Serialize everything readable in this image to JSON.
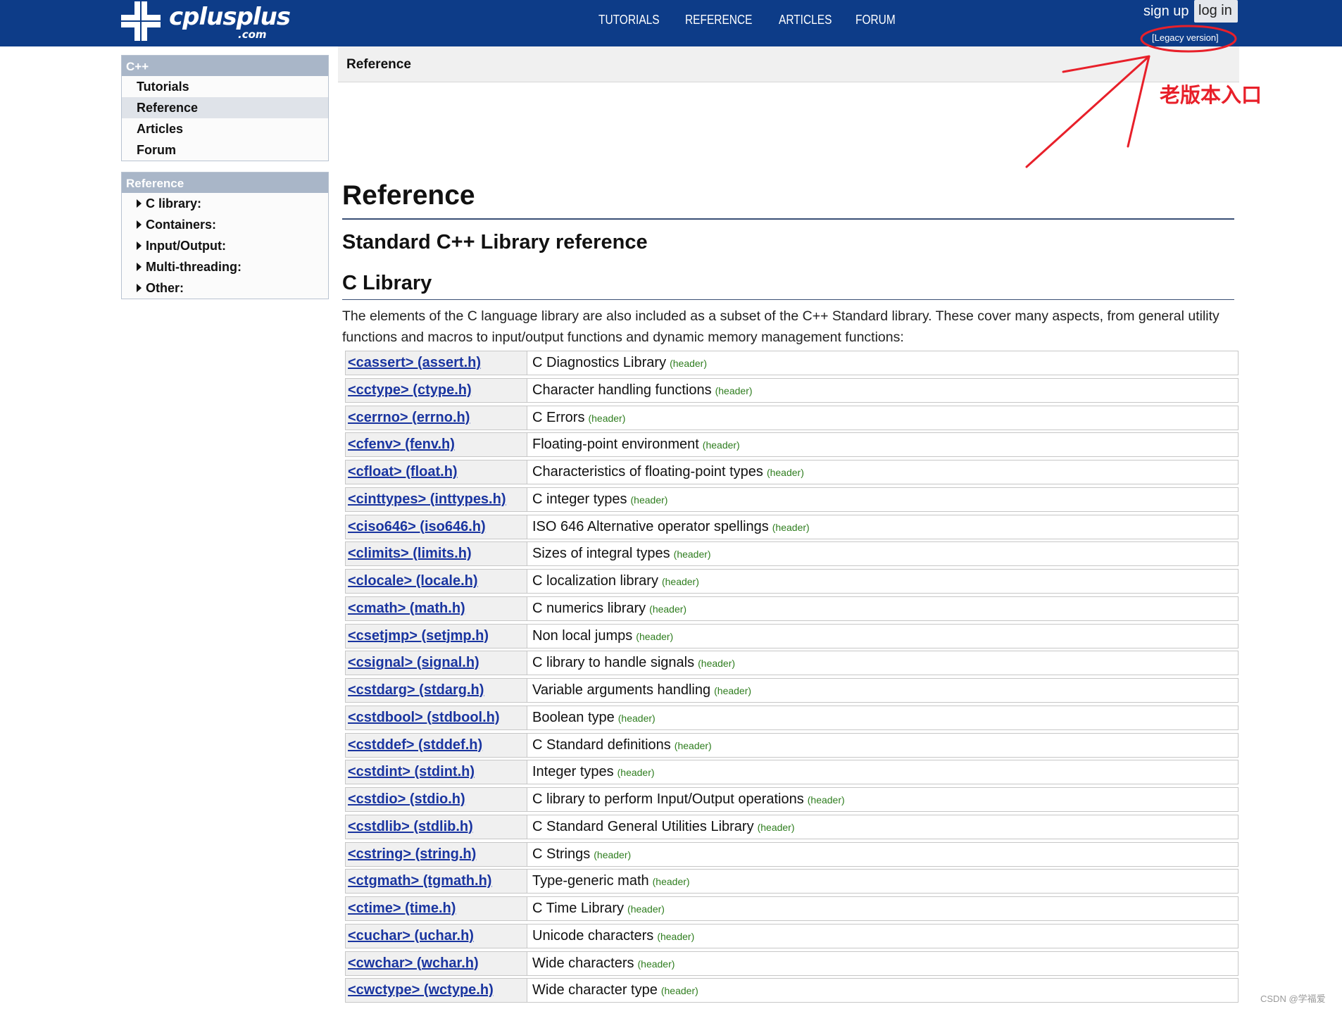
{
  "header": {
    "logo_text": "cplusplus",
    "logo_suffix": ".com",
    "nav": [
      "TUTORIALS",
      "REFERENCE",
      "ARTICLES",
      "FORUM"
    ],
    "signup_label": "sign up",
    "login_label": "log in",
    "legacy_label": "[Legacy version]"
  },
  "sidebar": {
    "section1_title": "C++",
    "section1_items": [
      "Tutorials",
      "Reference",
      "Articles",
      "Forum"
    ],
    "section1_active": "Reference",
    "section2_title": "Reference",
    "section2_items": [
      "C library:",
      "Containers:",
      "Input/Output:",
      "Multi-threading:",
      "Other:"
    ]
  },
  "main": {
    "breadcrumb": "Reference",
    "title": "Reference",
    "subtitle": "Standard C++ Library reference",
    "section_title": "C Library",
    "intro": "The elements of the C language library are also included as a subset of the C++ Standard library. These cover many aspects, from general utility functions and macros to input/output functions and dynamic memory management functions:",
    "tag": "(header)",
    "libraries": [
      {
        "name": "<cassert> (assert.h)",
        "desc": "C Diagnostics Library"
      },
      {
        "name": "<cctype> (ctype.h)",
        "desc": "Character handling functions"
      },
      {
        "name": "<cerrno> (errno.h)",
        "desc": "C Errors"
      },
      {
        "name": "<cfenv> (fenv.h)",
        "desc": "Floating-point environment"
      },
      {
        "name": "<cfloat> (float.h)",
        "desc": "Characteristics of floating-point types"
      },
      {
        "name": "<cinttypes> (inttypes.h)",
        "desc": "C integer types"
      },
      {
        "name": "<ciso646> (iso646.h)",
        "desc": "ISO 646 Alternative operator spellings"
      },
      {
        "name": "<climits> (limits.h)",
        "desc": "Sizes of integral types"
      },
      {
        "name": "<clocale> (locale.h)",
        "desc": "C localization library"
      },
      {
        "name": "<cmath> (math.h)",
        "desc": "C numerics library"
      },
      {
        "name": "<csetjmp> (setjmp.h)",
        "desc": "Non local jumps"
      },
      {
        "name": "<csignal> (signal.h)",
        "desc": "C library to handle signals"
      },
      {
        "name": "<cstdarg> (stdarg.h)",
        "desc": "Variable arguments handling"
      },
      {
        "name": "<cstdbool> (stdbool.h)",
        "desc": "Boolean type"
      },
      {
        "name": "<cstddef> (stddef.h)",
        "desc": "C Standard definitions"
      },
      {
        "name": "<cstdint> (stdint.h)",
        "desc": "Integer types"
      },
      {
        "name": "<cstdio> (stdio.h)",
        "desc": "C library to perform Input/Output operations"
      },
      {
        "name": "<cstdlib> (stdlib.h)",
        "desc": "C Standard General Utilities Library"
      },
      {
        "name": "<cstring> (string.h)",
        "desc": "C Strings"
      },
      {
        "name": "<ctgmath> (tgmath.h)",
        "desc": "Type-generic math"
      },
      {
        "name": "<ctime> (time.h)",
        "desc": "C Time Library"
      },
      {
        "name": "<cuchar> (uchar.h)",
        "desc": "Unicode characters"
      },
      {
        "name": "<cwchar> (wchar.h)",
        "desc": "Wide characters"
      },
      {
        "name": "<cwctype> (wctype.h)",
        "desc": "Wide character type"
      }
    ]
  },
  "annotation": {
    "text": "老版本入口",
    "color": "#e8202a"
  },
  "watermark": "CSDN @学福爱",
  "colors": {
    "header_bg": "#0d3c88",
    "link": "#1a35a0",
    "tag": "#2e7d1e",
    "sidebar_head": "#a9b6c8"
  }
}
